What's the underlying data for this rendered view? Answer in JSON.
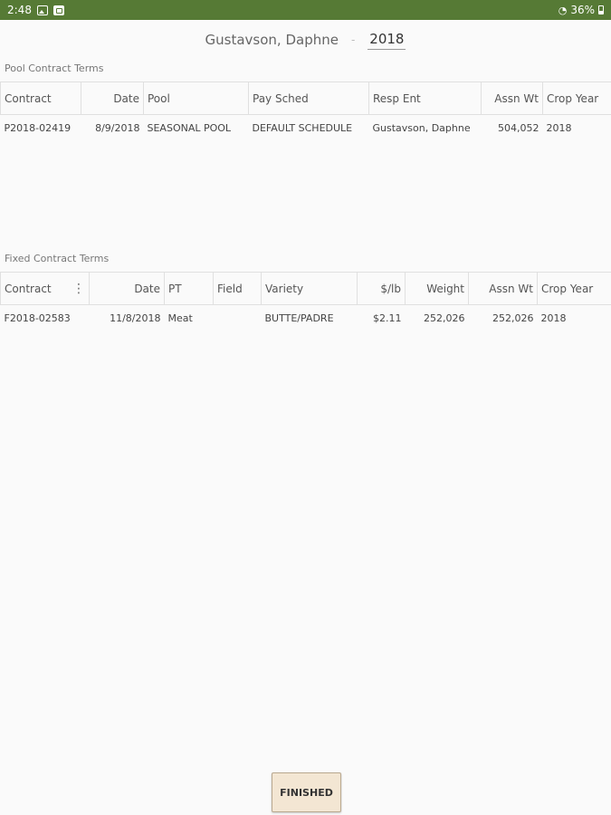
{
  "status_bar": {
    "time": "2:48",
    "battery_text": "36%",
    "icons": [
      "image-icon",
      "app-icon",
      "wifi-icon",
      "battery-icon"
    ]
  },
  "header": {
    "name": "Gustavson, Daphne",
    "separator": "-",
    "year": "2018"
  },
  "pool_section": {
    "title": "Pool Contract Terms",
    "columns": [
      "Contract",
      "Date",
      "Pool",
      "Pay Sched",
      "Resp Ent",
      "Assn Wt",
      "Crop Year"
    ],
    "rows": [
      [
        "P2018-02419",
        "8/9/2018",
        "SEASONAL POOL",
        "DEFAULT SCHEDULE",
        "Gustavson, Daphne",
        "504,052",
        "2018"
      ]
    ]
  },
  "fixed_section": {
    "title": "Fixed Contract Terms",
    "columns": [
      "Contract",
      "Date",
      "PT",
      "Field",
      "Variety",
      "$/lb",
      "Weight",
      "Assn Wt",
      "Crop Year"
    ],
    "rows": [
      [
        "F2018-02583",
        "11/8/2018",
        "Meat",
        "",
        "BUTTE/PADRE",
        "$2.11",
        "252,026",
        "252,026",
        "2018"
      ]
    ]
  },
  "finished_label": "FINISHED",
  "colors": {
    "status_bar": "#567a35",
    "button_bg": "#f3e6d3"
  }
}
